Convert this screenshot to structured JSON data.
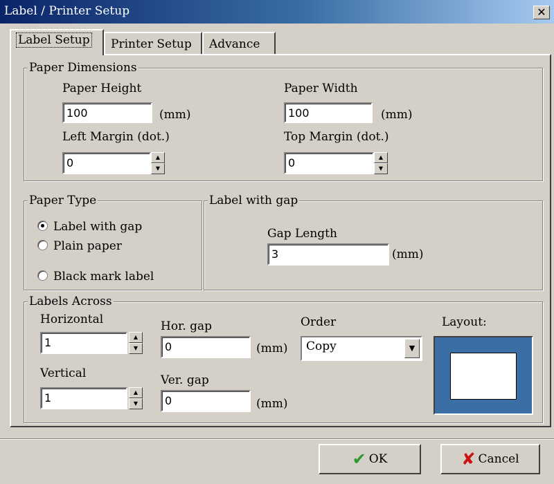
{
  "window": {
    "title": "Label / Printer Setup",
    "close_glyph": "✕"
  },
  "tabs": [
    {
      "label": "Label Setup"
    },
    {
      "label": "Printer Setup"
    },
    {
      "label": "Advance"
    }
  ],
  "paper_dimensions": {
    "legend": "Paper Dimensions",
    "paper_height_label": "Paper Height",
    "paper_height_value": "100",
    "paper_height_unit": "(mm)",
    "paper_width_label": "Paper Width",
    "paper_width_value": "100",
    "paper_width_unit": "(mm)",
    "left_margin_label": "Left Margin (dot.)",
    "left_margin_value": "0",
    "top_margin_label": "Top Margin (dot.)",
    "top_margin_value": "0"
  },
  "paper_type": {
    "legend": "Paper Type",
    "options": [
      {
        "label": "Label with gap",
        "selected": true
      },
      {
        "label": "Plain paper",
        "selected": false
      },
      {
        "label": "Black mark label",
        "selected": false
      }
    ]
  },
  "label_with_gap": {
    "legend": "Label with gap",
    "gap_length_label": "Gap Length",
    "gap_length_value": "3",
    "gap_length_unit": "(mm)"
  },
  "labels_across": {
    "legend": "Labels Across",
    "horizontal_label": "Horizontal",
    "horizontal_value": "1",
    "hor_gap_label": "Hor. gap",
    "hor_gap_value": "0",
    "hor_gap_unit": "(mm)",
    "order_label": "Order",
    "order_value": "Copy",
    "layout_label": "Layout:",
    "vertical_label": "Vertical",
    "vertical_value": "1",
    "ver_gap_label": "Ver. gap",
    "ver_gap_value": "0",
    "ver_gap_unit": "(mm)"
  },
  "buttons": {
    "ok_label": "OK",
    "ok_icon": "✔",
    "cancel_label": "Cancel",
    "cancel_icon": "✘"
  },
  "colors": {
    "ok_icon": "#2e9a2e",
    "cancel_icon": "#cc1111",
    "layout_border": "#3a6ea5"
  }
}
